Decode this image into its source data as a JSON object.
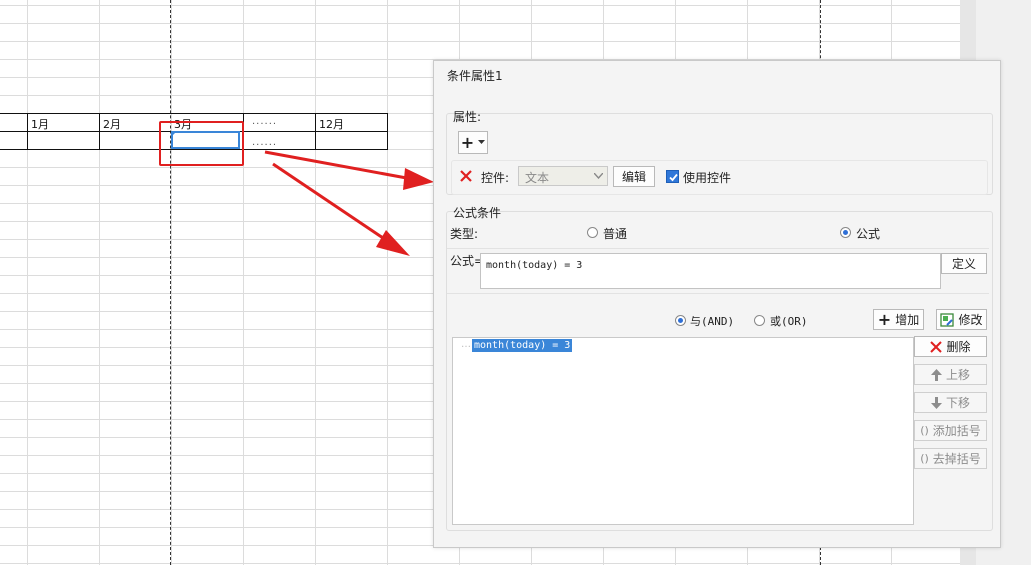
{
  "sheet": {
    "months": [
      "1月",
      "2月",
      "3月",
      "12月"
    ],
    "ellipsis": "......"
  },
  "dialog": {
    "title": "条件属性1",
    "attributes": {
      "title": "属性:",
      "control_label": "控件:",
      "control_value": "文本",
      "edit_label": "编辑",
      "use_control_label": "使用控件",
      "use_control_checked": true
    },
    "formula_condition": {
      "title": "公式条件",
      "type_label": "类型:",
      "type_options": [
        "普通",
        "公式"
      ],
      "type_selected": "公式",
      "formula_label": "公式=",
      "formula_value": "month(today) = 3",
      "define_label": "定义"
    },
    "logic": {
      "and_label": "与(AND)",
      "or_label": "或(OR)",
      "selected": "与(AND)",
      "add_label": "增加",
      "modify_label": "修改",
      "conditions": [
        "month(today) = 3"
      ]
    },
    "side_buttons": {
      "delete_label": "删除",
      "move_up_label": "上移",
      "move_down_label": "下移",
      "add_bracket_label": "添加括号",
      "remove_bracket_label": "去掉括号"
    }
  },
  "colors": {
    "selection": "#3a86d8",
    "highlight_box": "#e02020",
    "arrow": "#e02020",
    "list_highlight": "#3a86d8"
  }
}
